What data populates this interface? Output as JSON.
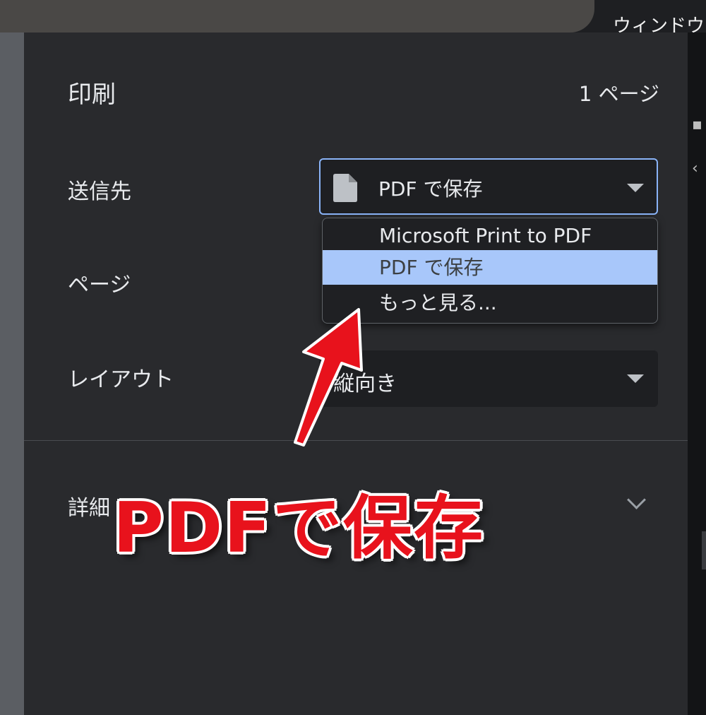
{
  "browser": {
    "window_label": "ウィンドウ"
  },
  "print_panel": {
    "title": "印刷",
    "page_count": "1 ページ",
    "destination": {
      "label": "送信先",
      "selected": "PDF で保存",
      "options": [
        "Microsoft Print to PDF",
        "PDF で保存",
        "もっと見る..."
      ]
    },
    "pages": {
      "label": "ページ"
    },
    "layout": {
      "label": "レイアウト",
      "value": "縦向き"
    },
    "more_settings": {
      "label": "詳細"
    }
  },
  "annotation": {
    "text": "PDFで保存",
    "color": "#e8121c"
  },
  "colors": {
    "panel_bg": "#292a2d",
    "accent": "#8ab4f8",
    "selected_option": "#a8c7fa"
  }
}
